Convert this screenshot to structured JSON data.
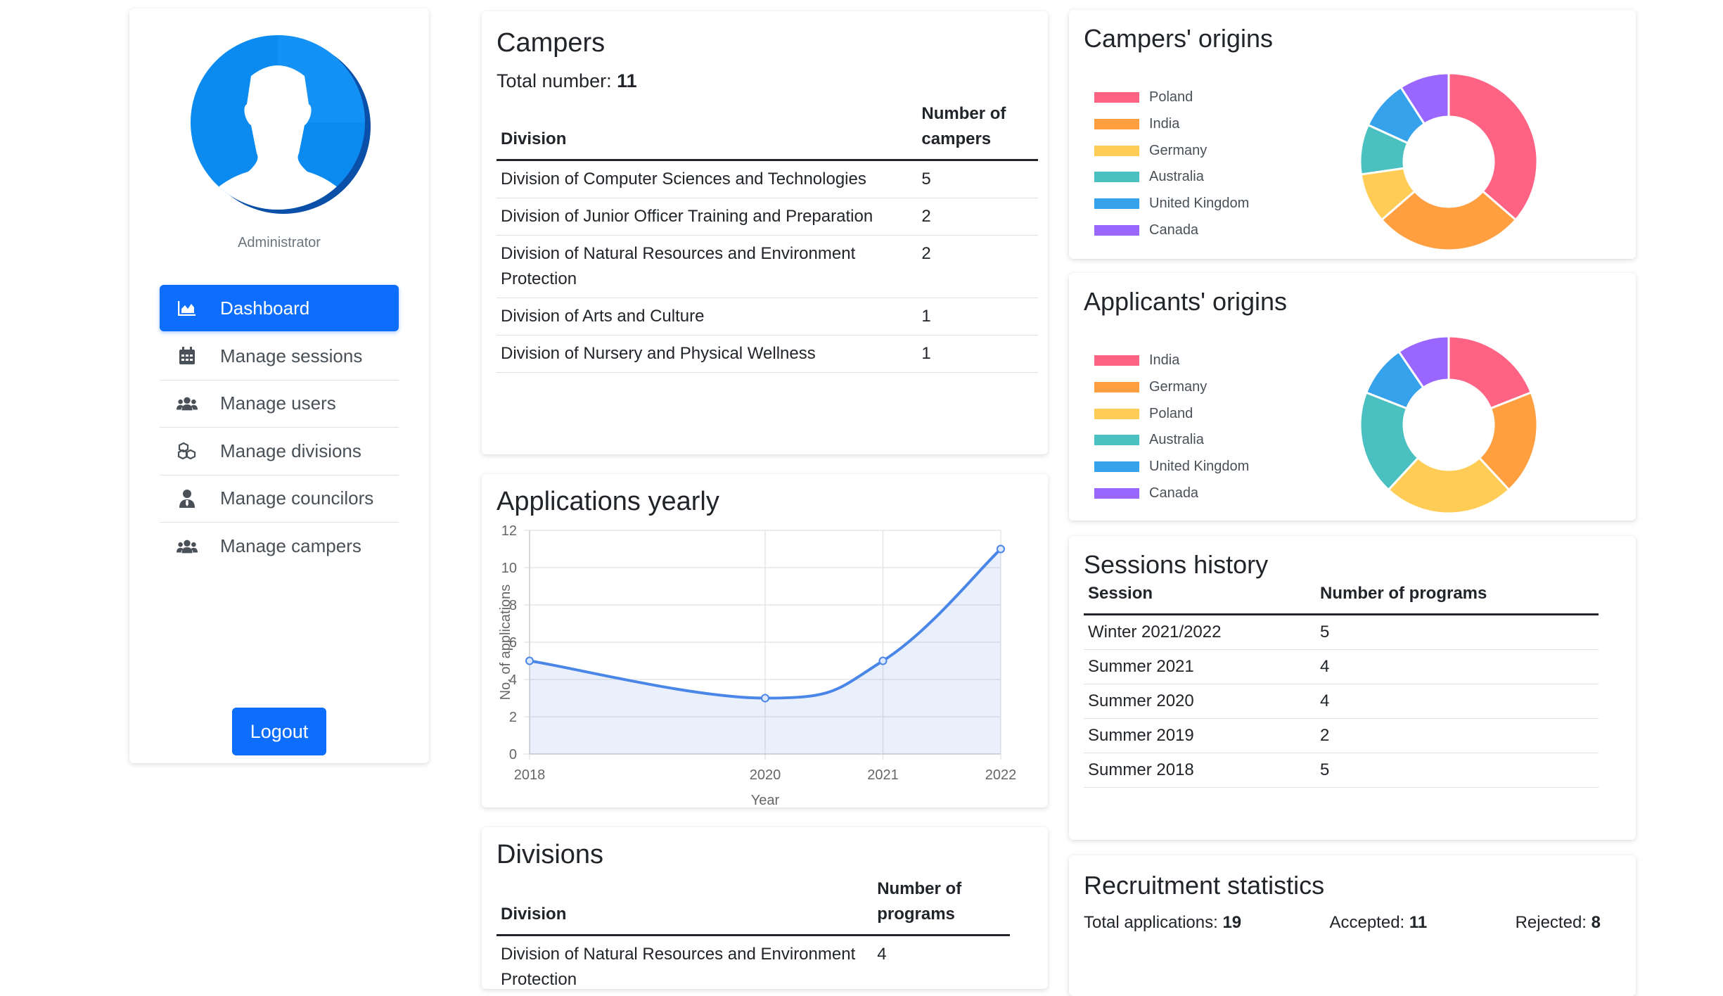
{
  "sidebar": {
    "role": "Administrator",
    "items": [
      {
        "label": "Dashboard",
        "icon": "chart-area-icon"
      },
      {
        "label": "Manage sessions",
        "icon": "calendar-icon"
      },
      {
        "label": "Manage users",
        "icon": "users-icon"
      },
      {
        "label": "Manage divisions",
        "icon": "cubes-icon"
      },
      {
        "label": "Manage councilors",
        "icon": "user-tie-icon"
      },
      {
        "label": "Manage campers",
        "icon": "users-icon"
      }
    ],
    "logout": "Logout"
  },
  "campers": {
    "title": "Campers",
    "total_label": "Total number:",
    "total_value": "11",
    "headers": [
      "Division",
      "Number of campers"
    ],
    "rows": [
      {
        "division": "Division of Computer Sciences and Technologies",
        "count": "5"
      },
      {
        "division": "Division of Junior Officer Training and Preparation",
        "count": "2"
      },
      {
        "division": "Division of Natural Resources and Environment Protection",
        "count": "2"
      },
      {
        "division": "Division of Arts and Culture",
        "count": "1"
      },
      {
        "division": "Division of Nursery and Physical Wellness",
        "count": "1"
      }
    ]
  },
  "applications": {
    "title": "Applications yearly"
  },
  "divisions": {
    "title": "Divisions",
    "headers": [
      "Division",
      "Number of programs"
    ],
    "rows": [
      {
        "division": "Division of Natural Resources and Environment Protection",
        "count": "4"
      }
    ]
  },
  "campers_origins": {
    "title": "Campers' origins"
  },
  "applicants_origins": {
    "title": "Applicants' origins"
  },
  "sessions": {
    "title": "Sessions history",
    "headers": [
      "Session",
      "Number of programs"
    ],
    "rows": [
      {
        "session": "Winter 2021/2022",
        "count": "5"
      },
      {
        "session": "Summer 2021",
        "count": "4"
      },
      {
        "session": "Summer 2020",
        "count": "4"
      },
      {
        "session": "Summer 2019",
        "count": "2"
      },
      {
        "session": "Summer 2018",
        "count": "5"
      }
    ]
  },
  "recruitment": {
    "title": "Recruitment statistics",
    "total_label": "Total applications:",
    "total_value": "19",
    "accepted_label": "Accepted:",
    "accepted_value": "11",
    "rejected_label": "Rejected:",
    "rejected_value": "8"
  },
  "colors": {
    "primary": "#0d6efd",
    "red": "#ff6384",
    "orange": "#ff9f40",
    "yellow": "#ffcd56",
    "teal": "#4bc0c0",
    "blue": "#36a2eb",
    "purple": "#9966ff",
    "line": "#4a86e8"
  },
  "chart_data": [
    {
      "type": "line",
      "title": "",
      "x": [
        "2018",
        "2020",
        "2021",
        "2022"
      ],
      "series": [
        {
          "values": [
            5,
            3,
            5,
            11
          ]
        }
      ],
      "xlabel": "Year",
      "ylabel": "No. of applications",
      "ylim": [
        0,
        12
      ],
      "yticks": [
        "0",
        "2",
        "4",
        "6",
        "8",
        "10",
        "12"
      ],
      "grid": true,
      "fill": true
    },
    {
      "type": "pie",
      "title": "",
      "categories": [
        "Poland",
        "India",
        "Germany",
        "Australia",
        "United Kingdom",
        "Canada"
      ],
      "values": [
        4,
        3,
        1,
        1,
        1,
        1
      ],
      "colors": [
        "#ff6384",
        "#ff9f40",
        "#ffcd56",
        "#4bc0c0",
        "#36a2eb",
        "#9966ff"
      ],
      "legend": "left"
    },
    {
      "type": "pie",
      "title": "",
      "categories": [
        "India",
        "Germany",
        "Poland",
        "Australia",
        "United Kingdom",
        "Canada"
      ],
      "values": [
        4,
        4,
        5,
        4,
        2,
        2
      ],
      "colors": [
        "#ff6384",
        "#ff9f40",
        "#ffcd56",
        "#4bc0c0",
        "#36a2eb",
        "#9966ff"
      ],
      "legend": "left"
    }
  ]
}
